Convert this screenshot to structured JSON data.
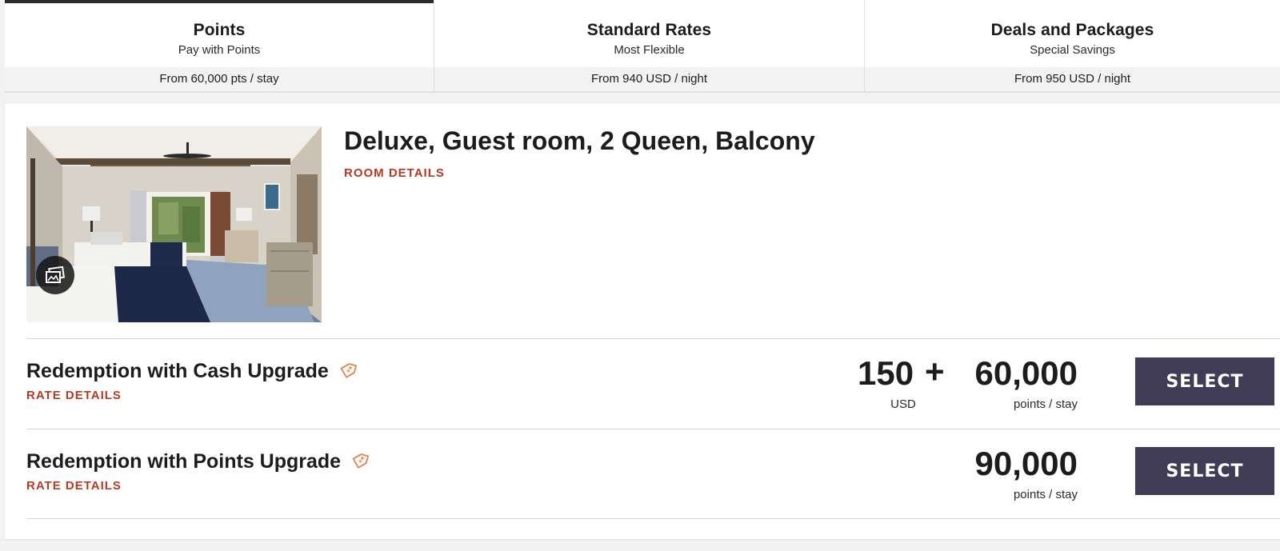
{
  "tabs": [
    {
      "title": "Points",
      "subtitle": "Pay with Points",
      "price": "From 60,000 pts / stay",
      "active": true
    },
    {
      "title": "Standard Rates",
      "subtitle": "Most Flexible",
      "price": "From 940 USD / night",
      "active": false
    },
    {
      "title": "Deals and Packages",
      "subtitle": "Special Savings",
      "price": "From 950 USD / night",
      "active": false
    }
  ],
  "room": {
    "title": "Deluxe, Guest room, 2 Queen, Balcony",
    "details_link": "ROOM DETAILS",
    "gallery_icon": "photo-gallery-icon"
  },
  "rates": [
    {
      "name": "Redemption with Cash Upgrade",
      "details_link": "RATE DETAILS",
      "tag_icon": "tag-icon",
      "cash_amount": "150",
      "cash_unit": "USD",
      "plus": "+",
      "points_amount": "60,000",
      "points_unit": "points / stay",
      "select_label": "SELECT"
    },
    {
      "name": "Redemption with Points Upgrade",
      "details_link": "RATE DETAILS",
      "tag_icon": "tag-icon",
      "points_amount": "90,000",
      "points_unit": "points / stay",
      "select_label": "SELECT"
    }
  ],
  "colors": {
    "accent_red": "#b63a22",
    "button_bg": "#413c55",
    "tag_orange": "#e8804a"
  }
}
